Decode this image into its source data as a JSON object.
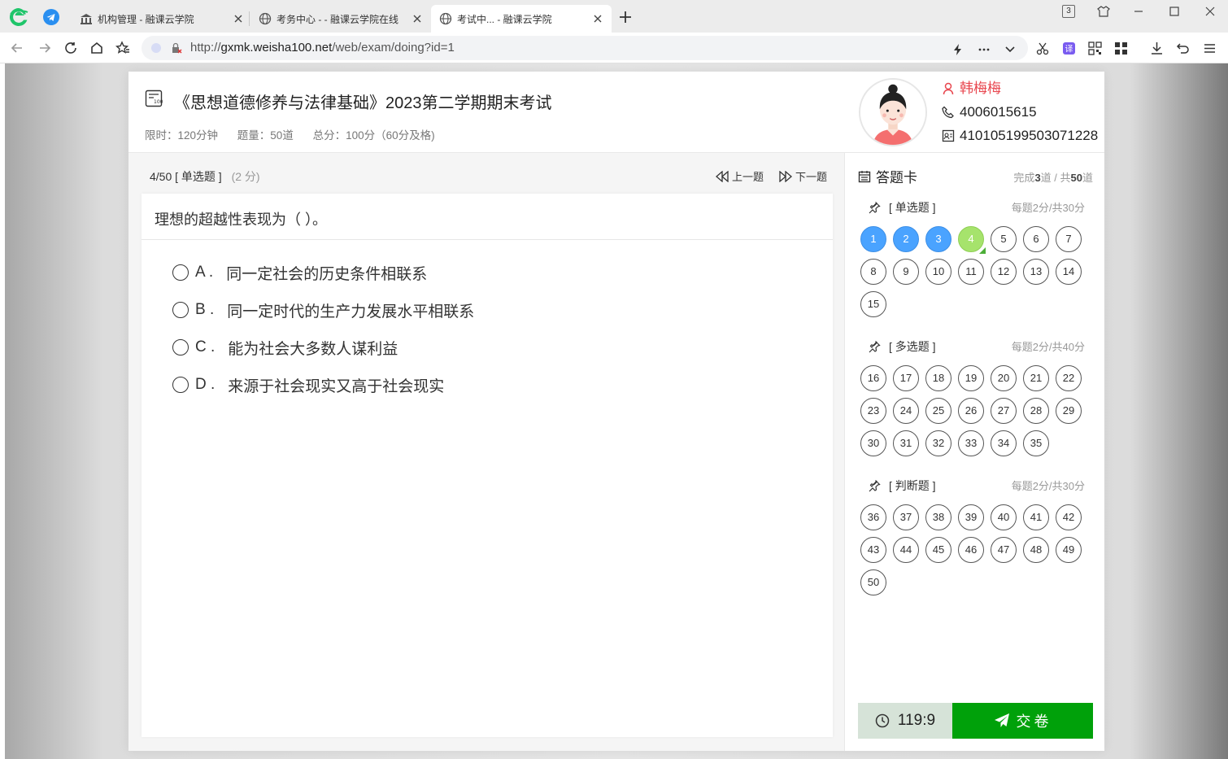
{
  "browser": {
    "tabs": [
      {
        "title": "机构管理 - 融课云学院",
        "icon": "bank-icon",
        "active": false
      },
      {
        "title": "考务中心 - - 融课云学院在线",
        "icon": "globe-icon",
        "active": false
      },
      {
        "title": "考试中... - 融课云学院",
        "icon": "globe-icon",
        "active": true
      }
    ],
    "tab_count_badge": "3",
    "url_scheme": "http://",
    "url_host": "gxmk.weisha100.net",
    "url_path": "/web/exam/doing?id=1"
  },
  "exam": {
    "title": "《思想道德修养与法律基础》2023第二学期期末考试",
    "time_limit": "限时：120分钟",
    "question_count": "题量：50道",
    "total_score": "总分：100分（60分及格)"
  },
  "student": {
    "name": "韩梅梅",
    "phone": "4006015615",
    "id_number": "410105199503071228"
  },
  "question": {
    "position": "4/50",
    "type": "[ 单选题 ]",
    "score": "(2 分)",
    "prev_label": "上一题",
    "next_label": "下一题",
    "text": "理想的超越性表现为（ ）。",
    "options": [
      {
        "letter": "A .",
        "text": "同一定社会的历史条件相联系"
      },
      {
        "letter": "B .",
        "text": "同一定时代的生产力发展水平相联系"
      },
      {
        "letter": "C .",
        "text": "能为社会大多数人谋利益"
      },
      {
        "letter": "D .",
        "text": "来源于社会现实又高于社会现实"
      }
    ]
  },
  "answer_card": {
    "title": "答题卡",
    "progress_prefix": "完成",
    "done_count": "3",
    "progress_mid": "道 / 共",
    "total_count": "50",
    "progress_suffix": "道",
    "sections": [
      {
        "name": "[ 单选题 ]",
        "rule": "每题2分/共30分",
        "numbers": [
          "1",
          "2",
          "3",
          "4",
          "5",
          "6",
          "7",
          "8",
          "9",
          "10",
          "11",
          "12",
          "13",
          "14",
          "15"
        ]
      },
      {
        "name": "[ 多选题 ]",
        "rule": "每题2分/共40分",
        "numbers": [
          "16",
          "17",
          "18",
          "19",
          "20",
          "21",
          "22",
          "23",
          "24",
          "25",
          "26",
          "27",
          "28",
          "29",
          "30",
          "31",
          "32",
          "33",
          "34",
          "35"
        ]
      },
      {
        "name": "[ 判断题 ]",
        "rule": "每题2分/共30分",
        "numbers": [
          "36",
          "37",
          "38",
          "39",
          "40",
          "41",
          "42",
          "43",
          "44",
          "45",
          "46",
          "47",
          "48",
          "49",
          "50"
        ]
      }
    ],
    "answered": [
      "1",
      "2",
      "3"
    ],
    "current": "4",
    "timer": "119:9",
    "submit_label": "交卷",
    "colors": {
      "answered": "#4aa3ff",
      "current": "#a6e36c",
      "submit": "#00a10a"
    }
  }
}
